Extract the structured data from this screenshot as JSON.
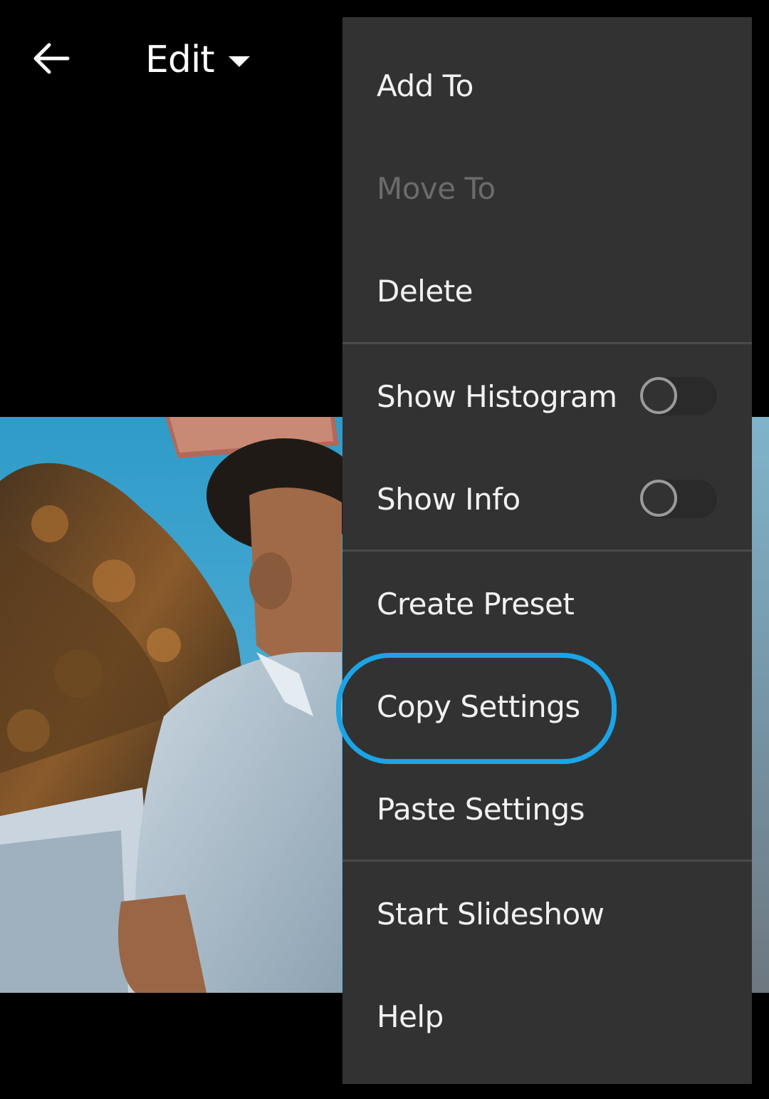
{
  "header": {
    "mode_label": "Edit",
    "back_icon": "arrow-left-icon",
    "caret_icon": "caret-down-icon"
  },
  "menu": {
    "items": [
      {
        "label": "Add To",
        "enabled": true
      },
      {
        "label": "Move To",
        "enabled": false
      },
      {
        "label": "Delete",
        "enabled": true
      },
      {
        "label": "Show Histogram",
        "toggle": false
      },
      {
        "label": "Show Info",
        "toggle": false
      },
      {
        "label": "Create Preset",
        "enabled": true
      },
      {
        "label": "Copy Settings",
        "enabled": true,
        "highlighted": true
      },
      {
        "label": "Paste Settings",
        "enabled": true
      },
      {
        "label": "Start Slideshow",
        "enabled": true
      },
      {
        "label": "Help",
        "enabled": true
      }
    ]
  },
  "colors": {
    "menu_background": "#323232",
    "text": "#f2f2f2",
    "disabled_text": "#6b6b6b",
    "highlight_ring": "#1ba4e6"
  }
}
